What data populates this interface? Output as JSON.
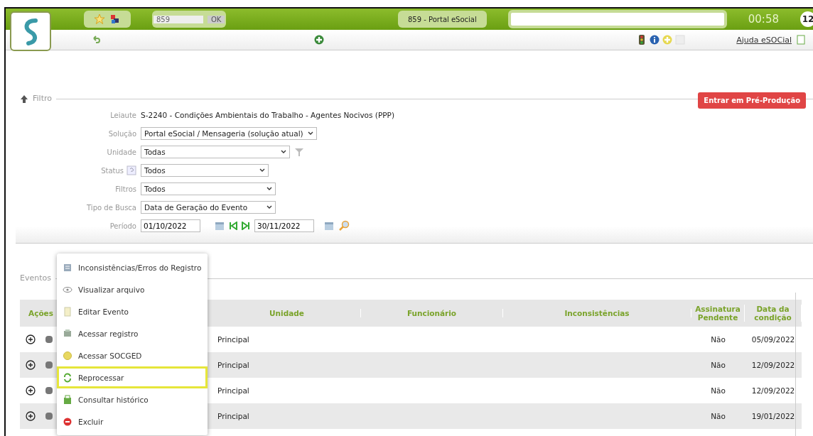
{
  "topbar": {
    "company_code": "859",
    "ok_button": "OK",
    "company_name": "859 - Portal eSocial",
    "time": "00:58",
    "badge": "12"
  },
  "toolbar": {
    "help_link": "Ajuda eSOCial"
  },
  "pre_production_button": "Entrar em Pré-Produção",
  "filter": {
    "title": "Filtro",
    "fields": [
      {
        "kind": "text",
        "label": "Leiaute",
        "value": "S-2240 - Condições Ambientais do Trabalho - Agentes Nocivos (PPP)"
      },
      {
        "kind": "select",
        "label": "Solução",
        "value": "Portal eSocial / Mensageria (solução atual)"
      },
      {
        "kind": "select_filter",
        "label": "Unidade",
        "value": "Todas"
      },
      {
        "kind": "select_help",
        "label": "Status",
        "value": "Todos"
      },
      {
        "kind": "select",
        "label": "Filtros",
        "value": "Todos"
      },
      {
        "kind": "select",
        "label": "Tipo de Busca",
        "value": "Data de Geração do Evento"
      },
      {
        "kind": "period",
        "label": "Período",
        "from": "01/10/2022",
        "to": "30/11/2022"
      }
    ]
  },
  "events": {
    "title": "Eventos",
    "table": {
      "columns": [
        "Ações",
        "Unidade",
        "Funcionário",
        "Inconsistências",
        "Assinatura Pendente",
        "Data da condição"
      ],
      "rows": [
        {
          "unidade": "Principal",
          "assinatura_pendente": "Não",
          "data_da_condicao": "05/09/2022"
        },
        {
          "unidade": "Principal",
          "assinatura_pendente": "Não",
          "data_da_condicao": "12/09/2022"
        },
        {
          "unidade": "Principal",
          "assinatura_pendente": "Não",
          "data_da_condicao": "12/09/2022"
        },
        {
          "unidade": "Principal",
          "assinatura_pendente": "Não",
          "data_da_condicao": "19/01/2022"
        }
      ]
    }
  },
  "context_menu": {
    "items": [
      {
        "label": "Inconsistências/Erros do Registro",
        "highlighted": false
      },
      {
        "label": "Visualizar arquivo",
        "highlighted": false
      },
      {
        "label": "Editar Evento",
        "highlighted": false
      },
      {
        "label": "Acessar registro",
        "highlighted": false
      },
      {
        "label": "Acessar SOCGED",
        "highlighted": false
      },
      {
        "label": "Reprocessar",
        "highlighted": true
      },
      {
        "label": "Consultar histórico",
        "highlighted": false
      },
      {
        "label": "Excluir",
        "highlighted": false
      }
    ]
  }
}
